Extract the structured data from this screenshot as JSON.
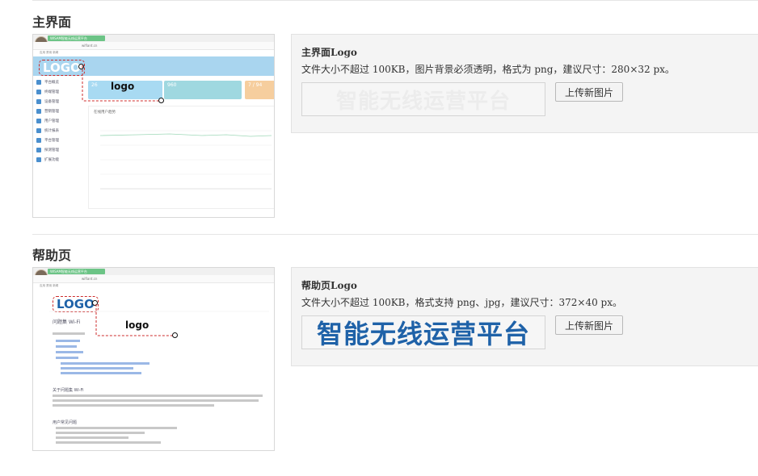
{
  "sections": [
    {
      "title": "主界面",
      "panel_title": "主界面Logo",
      "panel_desc": "文件大小不超过 100KB，图片背景必须透明，格式为 png，建议尺寸：280×32 px。",
      "logo_text": "智能无线运营平台",
      "button_label": "上传新图片",
      "preview": {
        "tab_label": "WISAM智能无线运营平台",
        "address": "wifiant.cn",
        "bookmarks": "应用    禁用   新闻",
        "logo_badge": "LOGO",
        "callout": "logo",
        "stats": [
          "26",
          "960",
          "7 / 94"
        ],
        "chart_title": "在线用户趋势",
        "sidebar": [
          "平台概览",
          "终端管理",
          "设备管理",
          "营销管理",
          "用户管理",
          "统计报表",
          "平台管理",
          "探测管理",
          "扩展功能"
        ]
      }
    },
    {
      "title": "帮助页",
      "panel_title": "帮助页Logo",
      "panel_desc": "文件大小不超过 100KB，格式支持 png、jpg，建议尺寸：372×40 px。",
      "logo_text": "智能无线运营平台",
      "button_label": "上传新图片",
      "preview": {
        "tab_label": "WISAM智能无线运营平台",
        "address": "wifiant.cn",
        "bookmarks": "应用    禁用   新闻",
        "logo_badge": "LOGO",
        "callout": "logo",
        "heading": "问题集 Wi-Fi",
        "about": "关于问题集 Wi-Fi",
        "user_faq": "用户常见问题"
      }
    }
  ],
  "colors": {
    "main_logo_text": "#ececec",
    "help_logo_text": "#1f62a8",
    "callout_dash": "#cc2b2b",
    "header_blue": "#a9d5ef"
  }
}
